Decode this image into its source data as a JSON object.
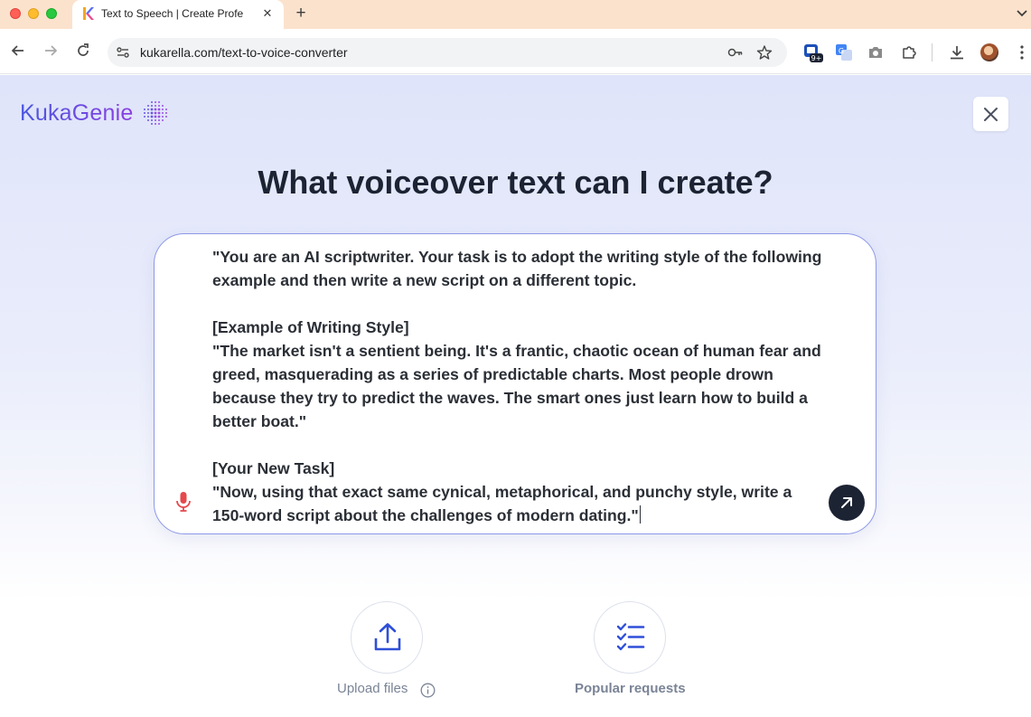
{
  "browser": {
    "tab_title": "Text to Speech | Create Profe",
    "tab_favicon": "K",
    "tab_close": "✕",
    "new_tab": "+",
    "url": "kukarella.com/text-to-voice-converter",
    "extension_badge": "9+"
  },
  "header": {
    "logo_text": "KukaGenie",
    "close_icon": "close-icon"
  },
  "main": {
    "headline": "What voiceover text can I create?",
    "prompt_text": "\"You are an AI scriptwriter. Your task is to adopt the writing style of the following example and then write a new script on a different topic.\n\n[Example of Writing Style]\n\"The market isn't a sentient being. It's a frantic, chaotic ocean of human fear and greed, masquerading as a series of predictable charts. Most people drown because they try to predict the waves. The smart ones just learn how to build a better boat.\"\n\n[Your New Task]\n\"Now, using that exact same cynical, metaphorical, and punchy style, write a 150-word script about the challenges of modern dating.\"",
    "mic_icon": "microphone-icon",
    "send_icon": "arrow-up-right-icon"
  },
  "actions": [
    {
      "label": "Upload files",
      "icon": "upload-icon"
    },
    {
      "label": "Popular requests",
      "icon": "checklist-icon"
    }
  ],
  "colors": {
    "tabbar_bg": "#fbe2cd",
    "accent": "#2f4fd8",
    "logo_gradient_start": "#4a57e0",
    "logo_gradient_end": "#8b3fe0",
    "send_button": "#1c2333",
    "mic": "#e5484d"
  }
}
